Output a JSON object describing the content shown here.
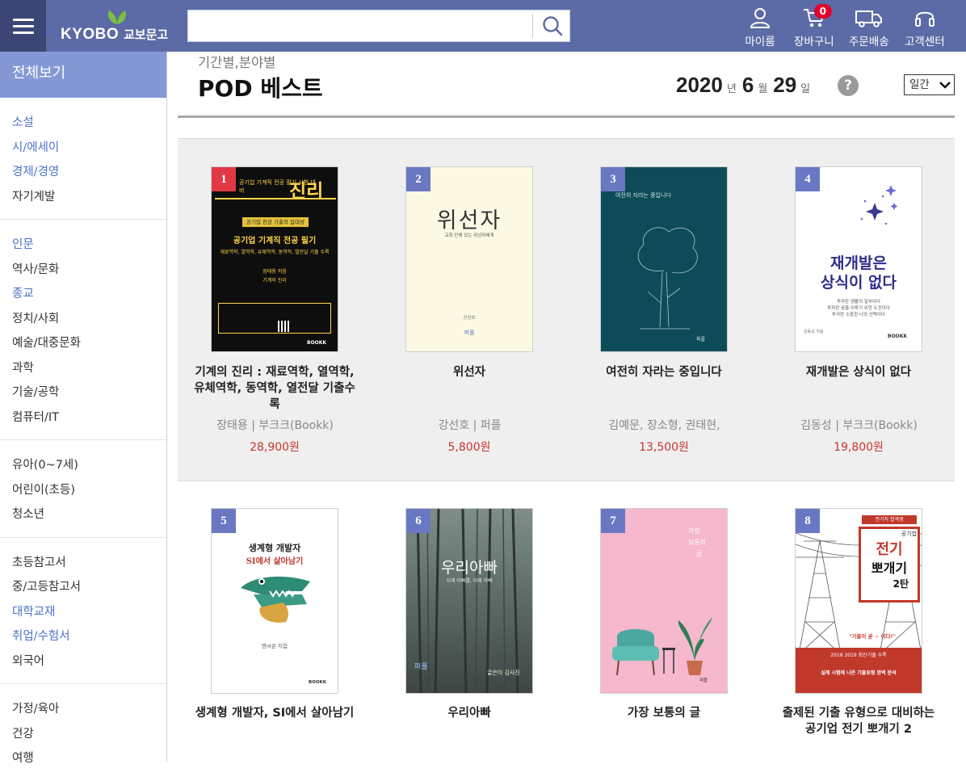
{
  "header": {
    "logo_text": "KYOBO",
    "logo_korean": "교보문고",
    "search": {
      "value": "",
      "placeholder": ""
    },
    "nav": [
      {
        "label": "마이룸",
        "icon": "person-icon"
      },
      {
        "label": "장바구니",
        "icon": "cart-icon",
        "badge": "0"
      },
      {
        "label": "주문배송",
        "icon": "delivery-truck-icon"
      },
      {
        "label": "고객센터",
        "icon": "headset-icon"
      }
    ]
  },
  "sidebar": {
    "head": "전체보기",
    "groups": [
      [
        {
          "label": "소설",
          "hl": true
        },
        {
          "label": "시/에세이",
          "hl": true
        },
        {
          "label": "경제/경영",
          "hl": true
        },
        {
          "label": "자기계발",
          "hl": false
        }
      ],
      [
        {
          "label": "인문",
          "hl": true
        },
        {
          "label": "역사/문화",
          "hl": false
        },
        {
          "label": "종교",
          "hl": true
        },
        {
          "label": "정치/사회",
          "hl": false
        },
        {
          "label": "예술/대중문화",
          "hl": false
        },
        {
          "label": "과학",
          "hl": false
        },
        {
          "label": "기술/공학",
          "hl": false
        },
        {
          "label": "컴퓨터/IT",
          "hl": false
        }
      ],
      [
        {
          "label": "유아(0~7세)",
          "hl": false
        },
        {
          "label": "어린이(초등)",
          "hl": false
        },
        {
          "label": "청소년",
          "hl": false
        }
      ],
      [
        {
          "label": "초등참고서",
          "hl": false
        },
        {
          "label": "중/고등참고서",
          "hl": false
        },
        {
          "label": "대학교재",
          "hl": true
        },
        {
          "label": "취업/수험서",
          "hl": true
        },
        {
          "label": "외국어",
          "hl": false
        }
      ],
      [
        {
          "label": "가정/육아",
          "hl": false
        },
        {
          "label": "건강",
          "hl": false
        },
        {
          "label": "여행",
          "hl": false
        }
      ]
    ]
  },
  "main": {
    "breadcrumb": "기간별,분야별",
    "title": "POD 베스트",
    "date": {
      "year": "2020",
      "year_unit": "년",
      "month": "6",
      "month_unit": "월",
      "day": "29",
      "day_unit": "일"
    },
    "help": "?",
    "period": "일간",
    "books": [
      {
        "rank": "1",
        "title": "기계의 진리 : 재료역학, 열역학, 유체역학, 동역학, 열전달 기출수록",
        "meta": "장태용 | 부크크(Bookk)",
        "price": "28,900원",
        "cover": {
          "top_text": "공기업 기계직 전공 필기 시험 대비",
          "big": "진리",
          "badge": "공기업 전공 기출의 집대성",
          "line1": "공기업 기계직 전공 필기",
          "line2": "재료역학, 열역학, 유체역학, 동역학, 열전달 기출 수록",
          "author": "장태용 저음",
          "author2": "기계의 진리",
          "publisher": "BOOKK"
        }
      },
      {
        "rank": "2",
        "title": "위선자",
        "meta": "강선호 | 퍼플",
        "price": "5,800원",
        "cover": {
          "big": "위선자",
          "sub": "교회 안에 있는 위선자에게",
          "author": "강선호",
          "publisher": "퍼플"
        }
      },
      {
        "rank": "3",
        "title": "여전히 자라는 중입니다",
        "meta": "김예문, 장소형, 권태현,",
        "price": "13,500원",
        "cover": {
          "big": "여전히 자라는 중입니다",
          "publisher": "퍼플"
        }
      },
      {
        "rank": "4",
        "title": "재개발은 상식이 없다",
        "meta": "김동성 | 부크크(Bookk)",
        "price": "19,800원",
        "cover": {
          "big1": "재개발은",
          "big2": "상식이 없다",
          "sub1": "투자란 생활의 일부이다",
          "sub2": "투자란 꿈을 이루기 위한 도전이다",
          "sub3": "투자란 소중한 나의 선택이다",
          "author": "김동성 지음",
          "publisher": "BOOKK"
        }
      },
      {
        "rank": "5",
        "title": "생계형 개발자, SI에서 살아남기",
        "meta": "",
        "price": "",
        "cover": {
          "line1": "생계형 개발자",
          "line2": "SI에서 살아남기",
          "author": "엔서은 지음",
          "publisher": "BOOKK"
        }
      },
      {
        "rank": "6",
        "title": "우리아빠",
        "meta": "",
        "price": "",
        "cover": {
          "big": "우리아빠",
          "sub": "오래 아빠를, 이제 아빠",
          "publisher": "퍼플",
          "author": "글쓴이 김사진"
        }
      },
      {
        "rank": "7",
        "title": "가장 보통의 글",
        "meta": "",
        "price": "",
        "cover": {
          "big1": "가장",
          "big2": "보통의",
          "big3": "글",
          "publisher": "퍼플"
        }
      },
      {
        "rank": "8",
        "title": "출제된 기출 유형으로 대비하는 공기업 전기 뽀개기 2",
        "meta": "",
        "price": "",
        "cover": {
          "tag": "전기직 합격생",
          "small": "공기업",
          "big1": "전기",
          "big2": "뽀개기",
          "big3": "2탄",
          "quote": "\"기출이 곧 ~ 이다!\"",
          "band": "2018 2019 최신기출 수록",
          "band2": "실제 시험에 나온 기출유형 완벽 분석"
        }
      }
    ]
  },
  "colors": {
    "header": "#5c6ba5",
    "sidebar_head": "#8598d6",
    "rank_top": "#e23744",
    "rank": "#6a77c3",
    "price": "#c9352f",
    "link": "#4d72c9"
  }
}
